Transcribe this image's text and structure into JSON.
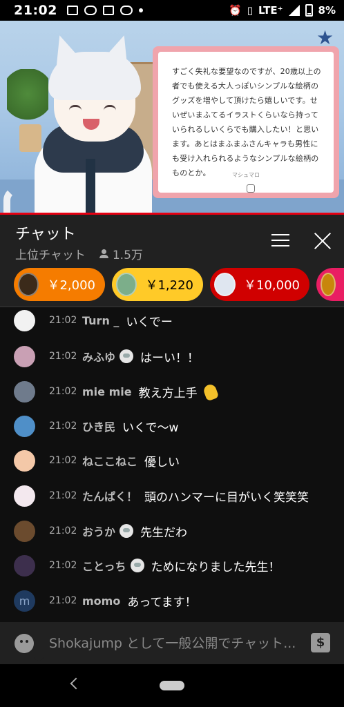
{
  "status_bar": {
    "time": "21:02",
    "network": "LTE⁺",
    "battery": "8%",
    "left_icons": [
      "gallery-icon",
      "line-icon",
      "app-icon",
      "spoon-icon",
      "dot-icon"
    ],
    "right_icons": [
      "alarm-icon",
      "vibrate-icon",
      "signal-icon",
      "battery-icon"
    ]
  },
  "video": {
    "message_text": "すごく失礼な要望なのですが、20歳以上の者でも使える大人っぽいシンプルな絵柄のグッズを増やして頂けたら嬉しいです。せいぜいまふてるイラストくらいなら持っていられるしいくらでも購入したい！と思います。あとはまふまふさんキャラも男性にも受け入れられるようなシンプルな絵柄のものとか。",
    "message_footer": "マシュマロ"
  },
  "chat_header": {
    "title": "チャット",
    "mode": "上位チャット",
    "viewers": "1.5万"
  },
  "tickers": [
    {
      "amount": "￥2,000",
      "color": "#f57c00",
      "avatar_color": "#3b2a1a"
    },
    {
      "amount": "￥1,220",
      "color": "#ffca28",
      "avatar_color": "#7cae8a",
      "text_color": "#000000"
    },
    {
      "amount": "￥10,000",
      "color": "#d00000",
      "avatar_color": "#dfe6f0"
    },
    {
      "amount": "",
      "color": "#e91e63",
      "avatar_color": "#c8860b"
    }
  ],
  "messages": [
    {
      "time": "21:02",
      "author": "Turn _",
      "text": "いくでー",
      "avatar_color": "#f2f2f2",
      "badge": false
    },
    {
      "time": "21:02",
      "author": "みふゆ",
      "text": "はーい！！",
      "avatar_color": "#c9a0b4",
      "badge": true
    },
    {
      "time": "21:02",
      "author": "mie mie",
      "text": "教え方上手",
      "avatar_color": "#6f7b8c",
      "badge": false,
      "emoji": "clapping-hands-emoji"
    },
    {
      "time": "21:02",
      "author": "ひき民",
      "text": "いくで〜w",
      "avatar_color": "#4f8fc8",
      "badge": false
    },
    {
      "time": "21:02",
      "author": "ねここねこ",
      "text": "優しい",
      "avatar_color": "#f4c8a8",
      "badge": false
    },
    {
      "time": "21:02",
      "author": "たんぱく！",
      "text": "頭のハンマーに目がいく笑笑笑",
      "avatar_color": "#f3e8ee",
      "badge": false
    },
    {
      "time": "21:02",
      "author": "おうか",
      "text": "先生だわ",
      "avatar_color": "#6b4b2e",
      "badge": true
    },
    {
      "time": "21:02",
      "author": "ことっち",
      "text": "ためになりました先生！",
      "avatar_color": "#3d2f4d",
      "badge": true
    },
    {
      "time": "21:02",
      "author": "momo",
      "text": "あってます！",
      "avatar_color": "#1f3a5f",
      "badge": false,
      "avatar_letter": "m"
    }
  ],
  "input": {
    "placeholder": "Shokajump として一般公開でチャット..."
  },
  "colors": {
    "background": "#0f0f0f",
    "header": "#212121",
    "accent": "#e60012"
  }
}
